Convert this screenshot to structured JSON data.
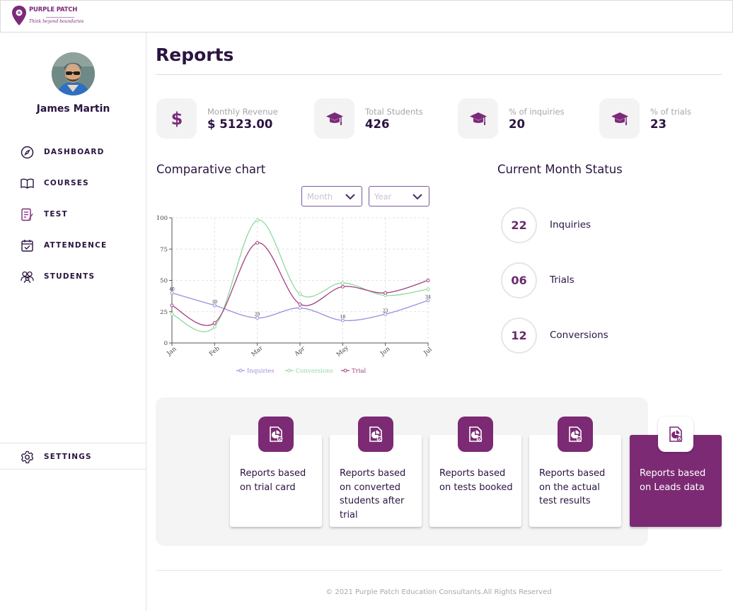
{
  "brand": {
    "name": "PURPLE PATCH",
    "tagline": "Think beyond boundaries"
  },
  "user": {
    "name": "James Martin"
  },
  "nav": [
    {
      "label": "DASHBOARD",
      "icon": "compass-icon"
    },
    {
      "label": "COURSES",
      "icon": "book-icon"
    },
    {
      "label": "TEST",
      "icon": "test-sheet-icon"
    },
    {
      "label": "ATTENDENCE",
      "icon": "calendar-check-icon"
    },
    {
      "label": "STUDENTS",
      "icon": "students-icon"
    }
  ],
  "settings": {
    "label": "SETTINGS",
    "icon": "gear-icon"
  },
  "page": {
    "title": "Reports"
  },
  "stats": [
    {
      "label": "Monthly Revenue",
      "value": "$ 5123.00",
      "icon": "dollar-icon"
    },
    {
      "label": "Total Students",
      "value": "426",
      "icon": "graduation-cap-icon"
    },
    {
      "label": "% of inquiries",
      "value": "20",
      "icon": "graduation-cap-icon"
    },
    {
      "label": "% of trials",
      "value": "23",
      "icon": "graduation-cap-icon"
    }
  ],
  "comparative": {
    "title": "Comparative chart",
    "month_placeholder": "Month",
    "year_placeholder": "Year"
  },
  "current_month": {
    "title": "Current Month Status",
    "items": [
      {
        "value": "22",
        "label": "Inquiries"
      },
      {
        "value": "06",
        "label": "Trials"
      },
      {
        "value": "12",
        "label": "Conversions"
      }
    ]
  },
  "chart_data": {
    "type": "line",
    "categories": [
      "Jan",
      "Feb",
      "Mar",
      "Apr",
      "May",
      "Jun",
      "Jul"
    ],
    "ylim": [
      0,
      100
    ],
    "yticks": [
      "0",
      "25",
      "50",
      "75",
      "100"
    ],
    "grid": true,
    "legend": "bottom",
    "series": [
      {
        "name": "Inquiries",
        "color": "#9b8fdc",
        "values": [
          40,
          30,
          20,
          28,
          18,
          23,
          34
        ]
      },
      {
        "name": "Conversions",
        "color": "#8fd89e",
        "values": [
          23,
          13,
          98,
          39,
          48,
          38,
          43
        ]
      },
      {
        "name": "Trial",
        "color": "#a0407e",
        "values": [
          30,
          16,
          80,
          31,
          45,
          40,
          50
        ]
      }
    ],
    "data_labels": [
      {
        "series": 0,
        "index": 0,
        "text": "40"
      },
      {
        "series": 0,
        "index": 1,
        "text": "30"
      },
      {
        "series": 0,
        "index": 2,
        "text": "20"
      },
      {
        "series": 0,
        "index": 4,
        "text": "18"
      },
      {
        "series": 0,
        "index": 5,
        "text": "23"
      },
      {
        "series": 0,
        "index": 6,
        "text": "34"
      }
    ]
  },
  "reports": [
    {
      "label": "Reports based on trial card",
      "active": false
    },
    {
      "label": "Reports based on converted students after trial",
      "active": false
    },
    {
      "label": "Reports based on tests booked",
      "active": false
    },
    {
      "label": "Reports based on the actual test results",
      "active": false
    },
    {
      "label": "Reports based on Leads data",
      "active": true
    }
  ],
  "footer": {
    "text": "© 2021 Purple Patch Education Consultants.All Rights Reserved"
  }
}
